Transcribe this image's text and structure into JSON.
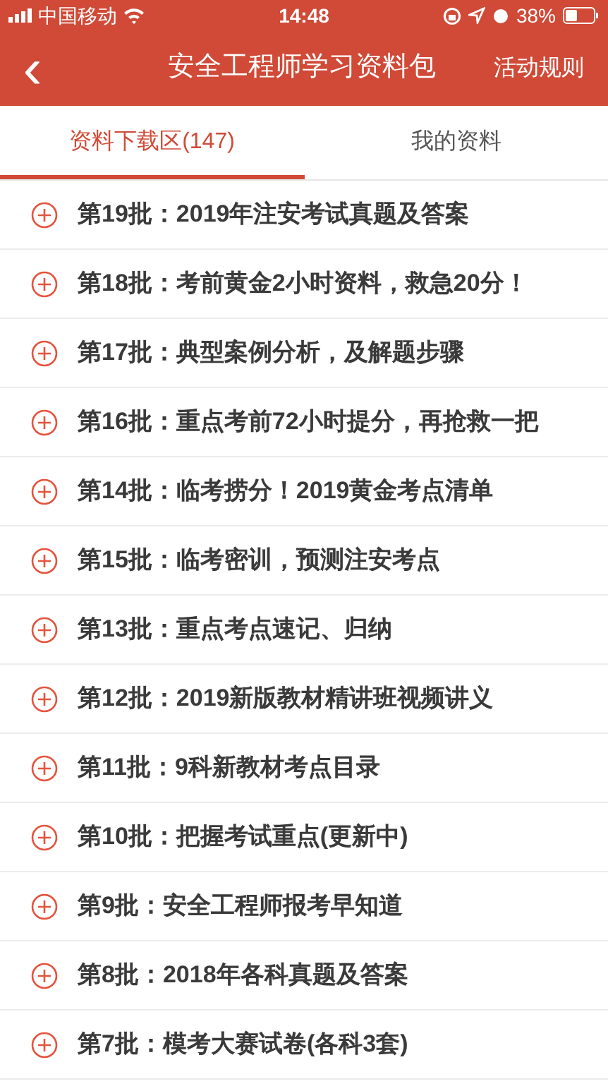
{
  "status_bar": {
    "carrier": "中国移动",
    "time": "14:48",
    "battery": "38%"
  },
  "header": {
    "back": "‹",
    "title": "安全工程师学习资料包",
    "action": "活动规则"
  },
  "tabs": [
    {
      "label": "资料下载区(147)",
      "selected": true
    },
    {
      "label": "我的资料",
      "selected": false
    }
  ],
  "items": [
    {
      "label": "第19批：2019年注安考试真题及答案"
    },
    {
      "label": "第18批：考前黄金2小时资料，救急20分！"
    },
    {
      "label": "第17批：典型案例分析，及解题步骤"
    },
    {
      "label": "第16批：重点考前72小时提分，再抢救一把"
    },
    {
      "label": "第14批：临考捞分！2019黄金考点清单"
    },
    {
      "label": "第15批：临考密训，预测注安考点"
    },
    {
      "label": "第13批：重点考点速记、归纳"
    },
    {
      "label": "第12批：2019新版教材精讲班视频讲义"
    },
    {
      "label": "第11批：9科新教材考点目录"
    },
    {
      "label": "第10批：把握考试重点(更新中)"
    },
    {
      "label": "第9批：安全工程师报考早知道"
    },
    {
      "label": "第8批：2018年各科真题及答案"
    },
    {
      "label": "第7批：模考大赛试卷(各科3套)"
    }
  ]
}
